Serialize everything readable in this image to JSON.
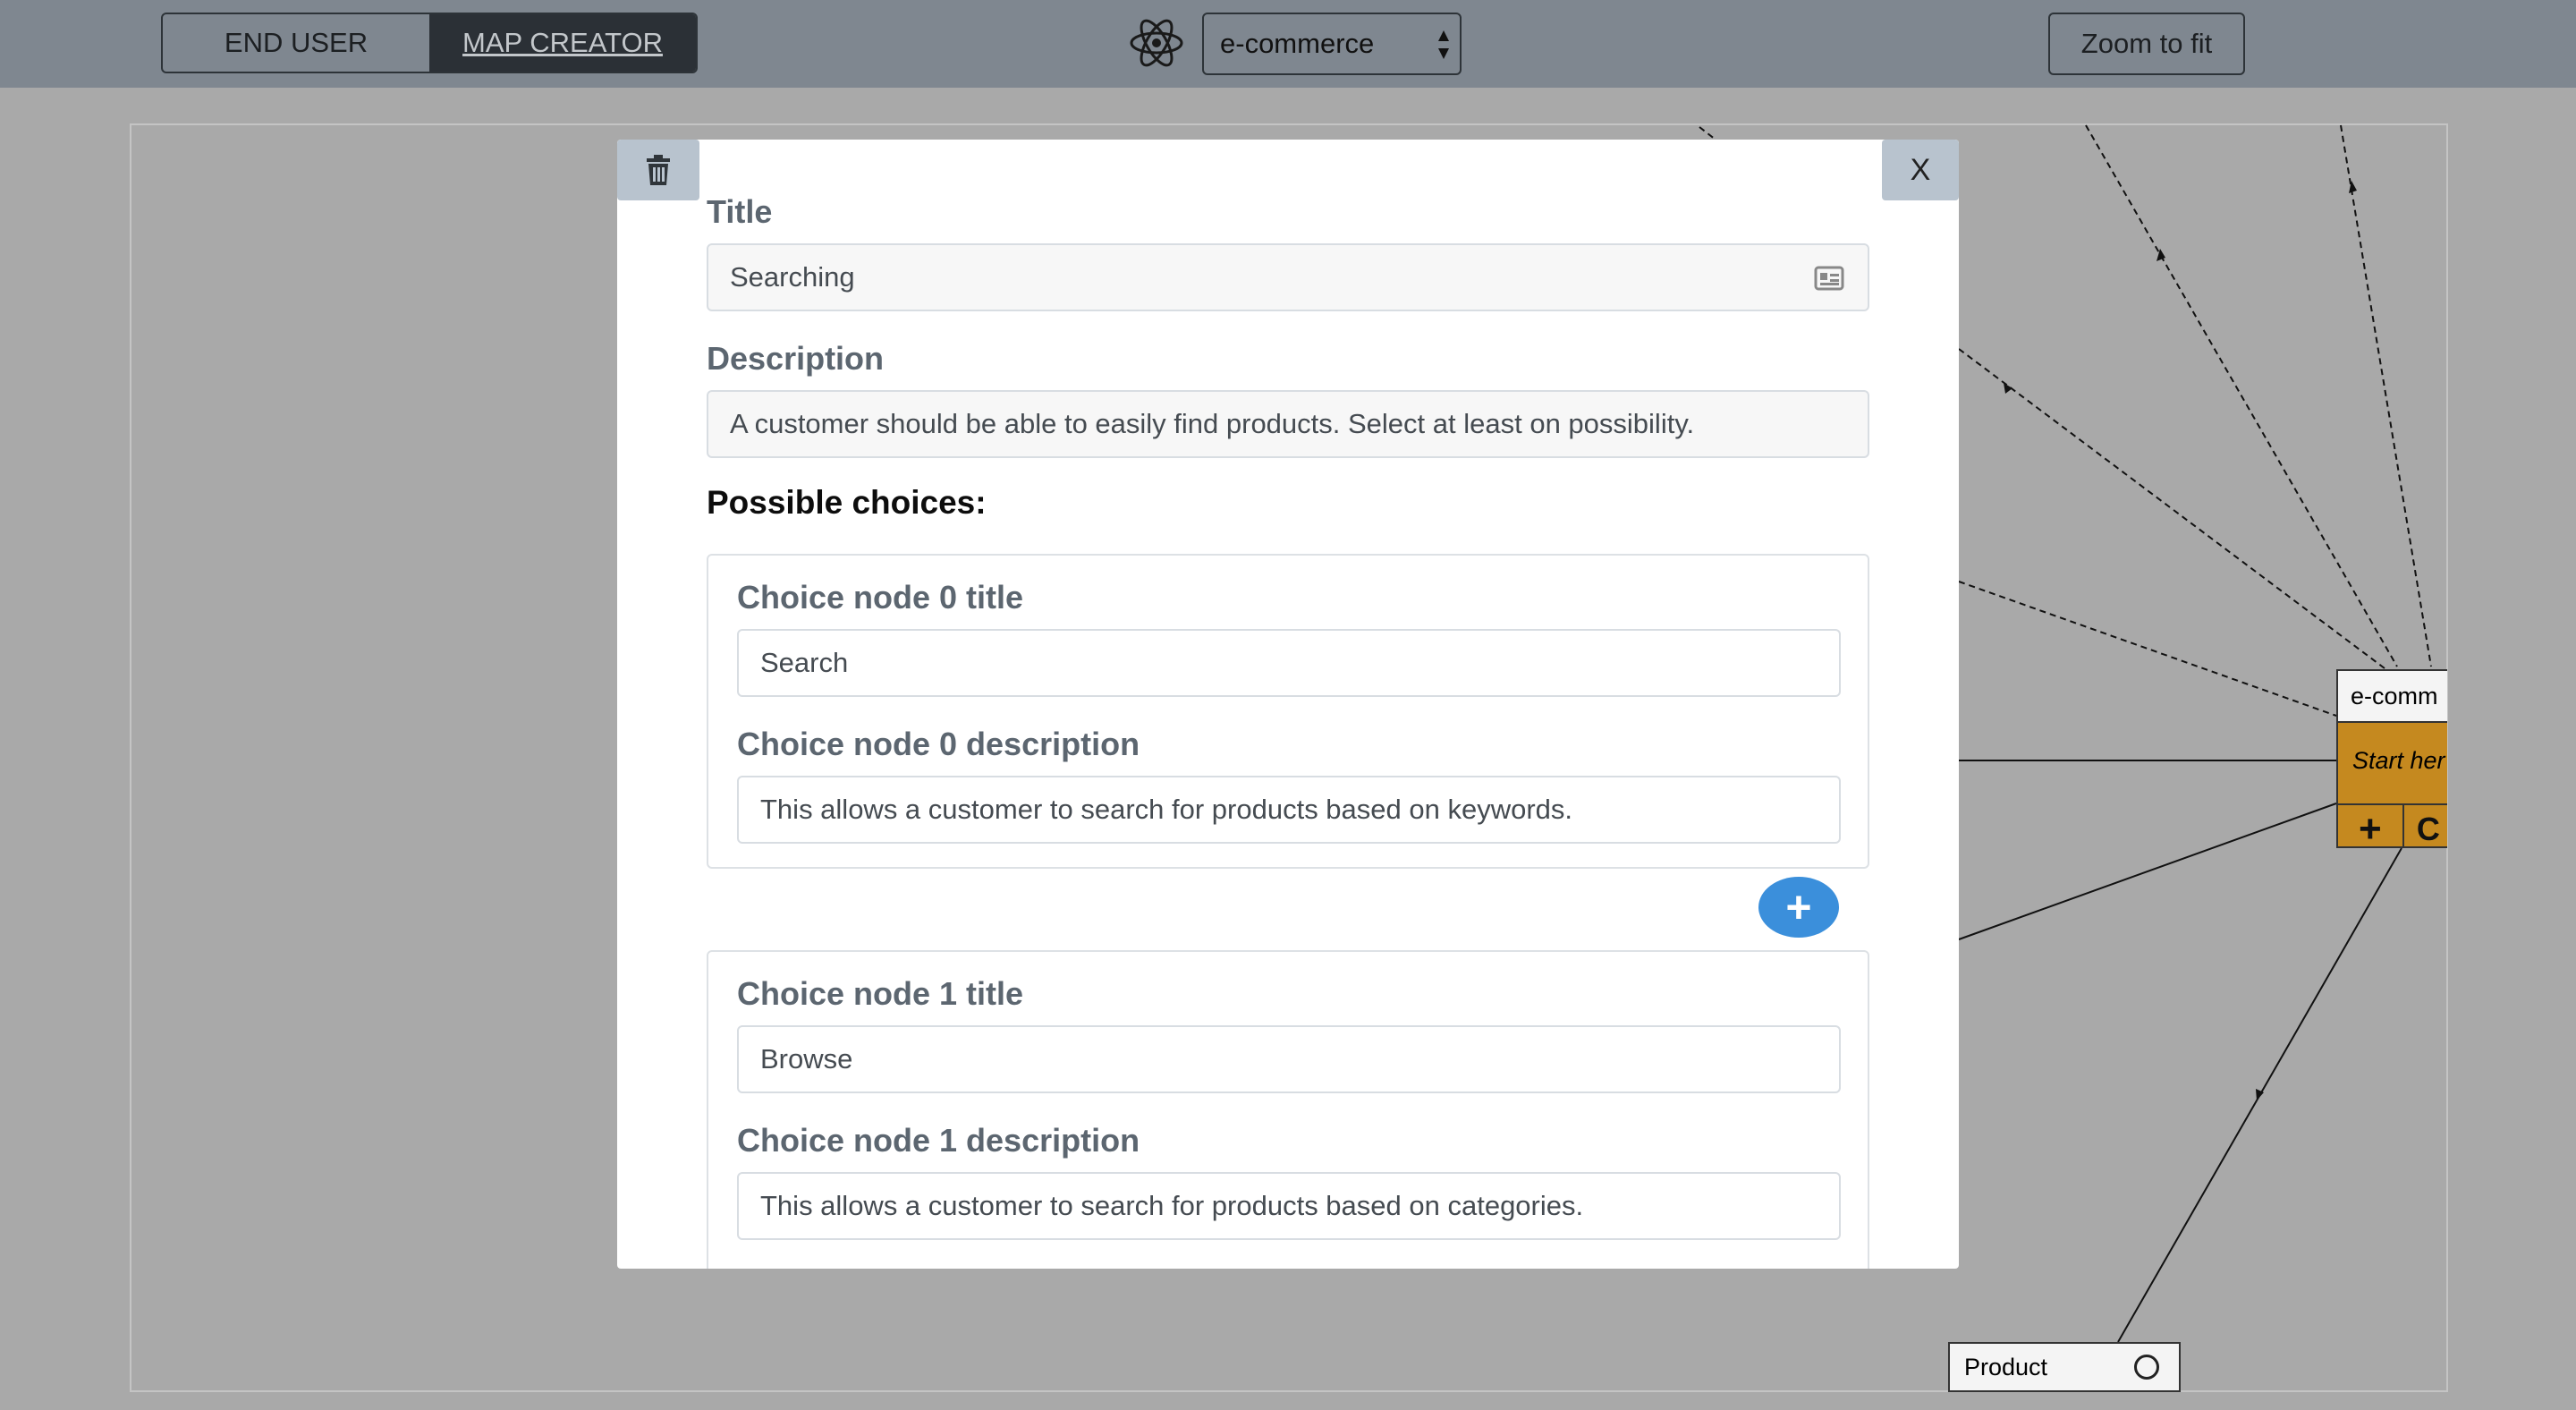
{
  "topbar": {
    "modes": [
      {
        "label": "END USER",
        "active": false
      },
      {
        "label": "MAP CREATOR",
        "active": true
      }
    ],
    "logo_icon": "react-atom-icon",
    "map_select": {
      "value": "e-commerce"
    },
    "zoom_button": "Zoom to fit"
  },
  "canvas": {
    "main_node": {
      "title": "e-comm",
      "body": "Start her",
      "buttons": [
        "+",
        "C"
      ]
    },
    "product_node": {
      "title": "Product"
    }
  },
  "modal": {
    "delete_icon": "trash-icon",
    "close_label": "X",
    "title_label": "Title",
    "title_value": "Searching",
    "description_label": "Description",
    "description_value": "A customer should be able to easily find products. Select at least on possibility.",
    "choices_heading": "Possible choices:",
    "add_choice_label": "+",
    "choices": [
      {
        "title_label": "Choice node 0 title",
        "title_value": "Search",
        "description_label": "Choice node 0 description",
        "description_value": "This allows a customer to search for products based on keywords."
      },
      {
        "title_label": "Choice node 1 title",
        "title_value": "Browse",
        "description_label": "Choice node 1 description",
        "description_value": "This allows a customer to search for products based on categories."
      }
    ]
  },
  "colors": {
    "topbar": "#7f8790",
    "canvas": "#a9a9a9",
    "node_accent": "#c5891f",
    "add_button": "#3b8fdb",
    "close_button": "#b8c3ce"
  }
}
